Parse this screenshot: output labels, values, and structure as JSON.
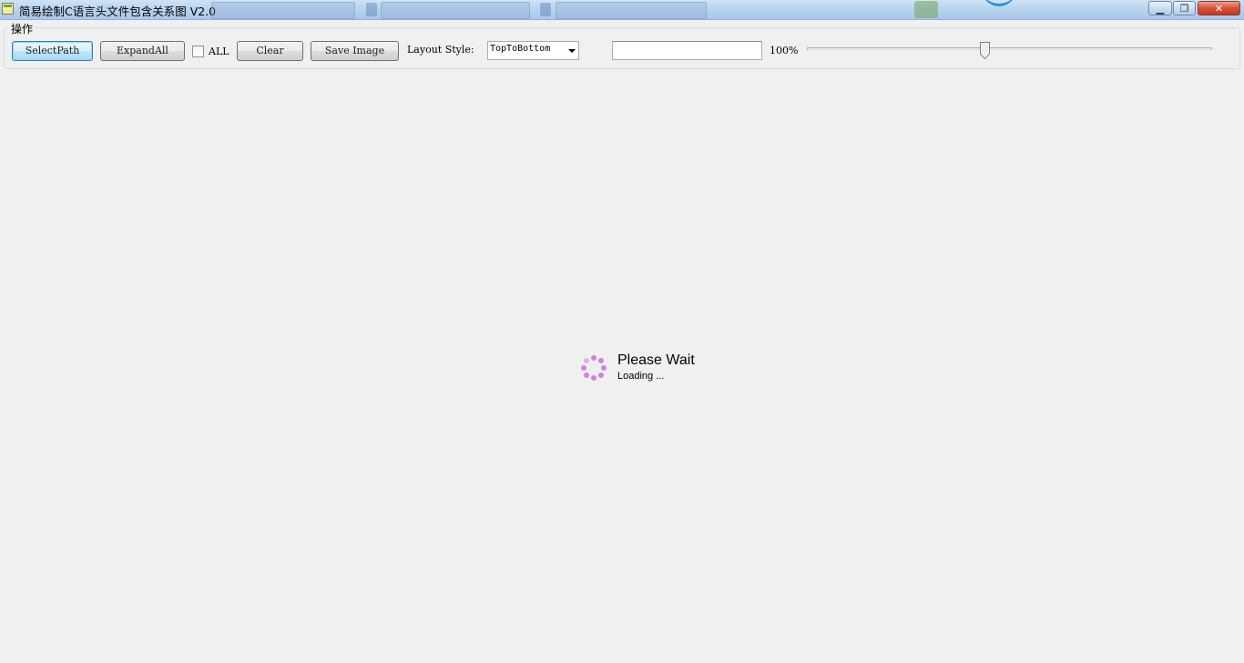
{
  "window": {
    "title": "简易绘制C语言头文件包含关系图 V2.0",
    "controls": {
      "minimize_glyph": "▁",
      "restore_glyph": "❐",
      "close_glyph": "✕"
    }
  },
  "group": {
    "label": "操作"
  },
  "toolbar": {
    "select_path_label": "SelectPath",
    "expand_all_label": "ExpandAll",
    "all_checkbox_label": "ALL",
    "all_checked": false,
    "clear_label": "Clear",
    "save_image_label": "Save Image",
    "layout_style_label": "Layout Style:",
    "layout_style_value": "TopToBottom",
    "search_value": "",
    "zoom_label": "100%",
    "zoom_slider_level": 0.44
  },
  "loading": {
    "title": "Please Wait",
    "subtitle": "Loading ...",
    "spinner_color": "#cf86d8"
  },
  "colors": {
    "background": "#f0f0f0",
    "titlebar": "#b9d4ef",
    "focus_border": "#3c7fb1"
  }
}
